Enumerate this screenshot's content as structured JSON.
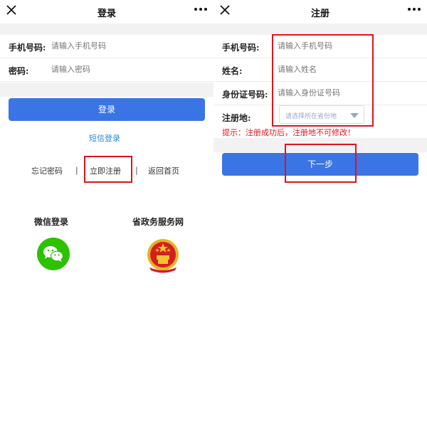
{
  "login_screen": {
    "title": "登录",
    "phone_label": "手机号码:",
    "phone_placeholder": "请输入手机号码",
    "password_label": "密码:",
    "password_placeholder": "请输入密码",
    "login_button": "登录",
    "sms_login_link": "短信登录",
    "forgot_password_link": "忘记密码",
    "register_link": "立即注册",
    "back_home_link": "返回首页",
    "separator": "|",
    "wechat_login_label": "微信登录",
    "gov_service_label": "省政务服务网"
  },
  "register_screen": {
    "title": "注册",
    "phone_label": "手机号码:",
    "phone_placeholder": "请输入手机号码",
    "name_label": "姓名:",
    "name_placeholder": "请输入姓名",
    "id_label": "身份证号码:",
    "id_placeholder": "请输入身份证号码",
    "region_label": "注册地:",
    "region_placeholder": "请选择所在省份地",
    "hint_text": "提示：注册成功后，注册地不可修改！",
    "next_button": "下一步"
  },
  "icons": {
    "close": "close-icon",
    "more": "more-dots-icon",
    "wechat": "wechat-icon",
    "emblem": "national-emblem-icon",
    "dropdown": "chevron-down-icon"
  },
  "colors": {
    "primary_blue": "#3b74e4",
    "highlight_red": "#e0131c",
    "link_blue": "#2f86d8",
    "wechat_green": "#2dc100",
    "emblem_red": "#d21f1f"
  }
}
